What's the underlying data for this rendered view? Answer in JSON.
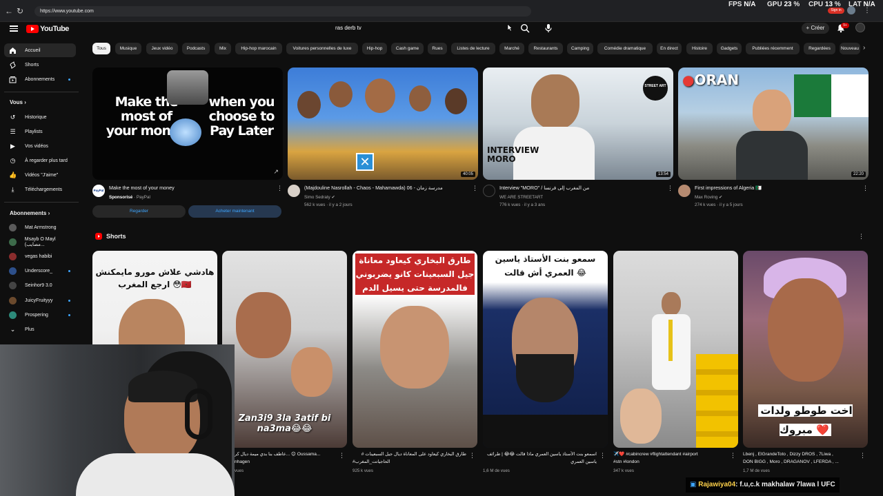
{
  "browser": {
    "url": "https://www.youtube.com",
    "stats": {
      "fps_label": "FPS",
      "fps_value": "N/A",
      "gpu_label": "GPU",
      "gpu_value": "23",
      "cpu_label": "CPU",
      "cpu_value": "13",
      "lat_label": "LAT",
      "lat_value": "N/A"
    },
    "signin_label": "Sign in"
  },
  "header": {
    "logo_text": "YouTube",
    "search_query": "ras derb tv",
    "create_label": "Créer",
    "notification_count": "9+"
  },
  "sidebar": {
    "main": [
      {
        "label": "Accueil",
        "icon": "home-icon"
      },
      {
        "label": "Shorts",
        "icon": "shorts-icon"
      },
      {
        "label": "Abonnements",
        "icon": "subscriptions-icon"
      }
    ],
    "you_heading": "Vous",
    "you_items": [
      {
        "label": "Historique",
        "icon": "history-icon"
      },
      {
        "label": "Playlists",
        "icon": "playlists-icon"
      },
      {
        "label": "Vos vidéos",
        "icon": "your-videos-icon"
      },
      {
        "label": "À regarder plus tard",
        "icon": "watch-later-icon"
      },
      {
        "label": "Vidéos \"J'aime\"",
        "icon": "like-icon"
      },
      {
        "label": "Téléchargements",
        "icon": "download-icon"
      }
    ],
    "subs_heading": "Abonnements",
    "subs": [
      {
        "label": "Mat Armstrong",
        "color": "#5a5a5a"
      },
      {
        "label": "Msayb O Mayl (مصايب...",
        "color": "#3d6b4a"
      },
      {
        "label": "vegas habibi",
        "color": "#8a2d2d"
      },
      {
        "label": "Underscore_",
        "color": "#2d4f8a"
      },
      {
        "label": "Seinhor9 3.0",
        "color": "#444444"
      },
      {
        "label": "JuicyFruityyy",
        "color": "#6b4a2d"
      },
      {
        "label": "Prospering",
        "color": "#2d8a7a"
      },
      {
        "label": "Plus",
        "color": "#0f0f0f"
      }
    ]
  },
  "chips": [
    "Tous",
    "Musique",
    "Jeux vidéo",
    "Podcasts",
    "Mix",
    "Hip-hop marocain",
    "Voitures personnelles de luxe",
    "Hip-hop",
    "Cash game",
    "Rues",
    "Listes de lecture",
    "Marché",
    "Restaurants",
    "Camping",
    "Comédie dramatique",
    "En direct",
    "Histoire",
    "Gadgets",
    "Publiées récemment",
    "Regardées",
    "Nouveau"
  ],
  "videos": [
    {
      "kind": "ad",
      "thumb_text_left": "Make the most of your money",
      "thumb_text_right": "when you choose to Pay Later",
      "title": "Make the most of your money",
      "channel_avatar_text": "PayPal",
      "sponsored": "Sponsorisé",
      "advertiser": "PayPal",
      "btn_watch": "Regarder",
      "btn_buy": "Acheter maintenant"
    },
    {
      "title": "(Majdouline Nasrollah - Chaos - Mahamawda) 06 - مدرسة زمان",
      "channel": "Simo Sedraty",
      "meta": "562 k vues · il y a 2 jours",
      "duration": "40:05"
    },
    {
      "title": "Interview \"MORO\" / من المغرب إلى فرنسا",
      "channel": "WE ARE STREETART",
      "meta": "776 k vues · il y a 3 ans",
      "duration": "13:54",
      "thumb_text": "INTERVIEW MORO",
      "badge_text": "STREET ART"
    },
    {
      "title": "First impressions of Algeria 🇩🇿",
      "channel": "Max Roving",
      "meta": "274 k vues · il y a 5 jours",
      "duration": "22:20",
      "thumb_text": "ORAN"
    }
  ],
  "shorts_heading": "Shorts",
  "shorts": [
    {
      "overlay": "هادشي علاش مورو مايمكنش ارجع المغرب 😳🇲🇦",
      "title": "",
      "meta": ""
    },
    {
      "overlay": "Zan3i9 3la 3atif bi na3ma😂😂",
      "title": "عاطف بنا بدي ميمة ديال كر... 😊 Oussama...",
      "title2": "nhagen",
      "meta": "vues"
    },
    {
      "overlay": "طارق البخاري كيعاود معاناة جيل السبعينات كانو يضربوني فالمدرسة حتى يسيل الدم",
      "title": "طارق البخاري كيعاود على المعاناة ديال جيل السبعينات #",
      "title2": "#الحاجياتت_المغرب",
      "meta": "925 k vues"
    },
    {
      "overlay": "سمعو بنت الأستاذ ياسين العمري أش قالت 😂",
      "title": "اسمعو بنت الأستاذ ياسين العمري ماذا قالت 😂😂 | طرائف",
      "title2": "ياسين العمري",
      "meta": "1,6 M de vues"
    },
    {
      "overlay": "",
      "title": "✈️❤️ #cabincrew #flightattendant #airport",
      "title2": "#stn #london",
      "meta": "347 k vues"
    },
    {
      "overlay": "اخت طوطو ولدات مبروك ❤️",
      "title": "Lbenj , ElGrandeToto , Dizzy DROS , 7Liwa ,",
      "title2": "DON BIGG , Moro , DRAGANOV , LFERDA , ...",
      "meta": "1,7 M de vues"
    }
  ],
  "chat_overlay": {
    "user": "Rajawiya04",
    "message": ": f.u,c.k makhalaw 7lawa l UFC"
  }
}
